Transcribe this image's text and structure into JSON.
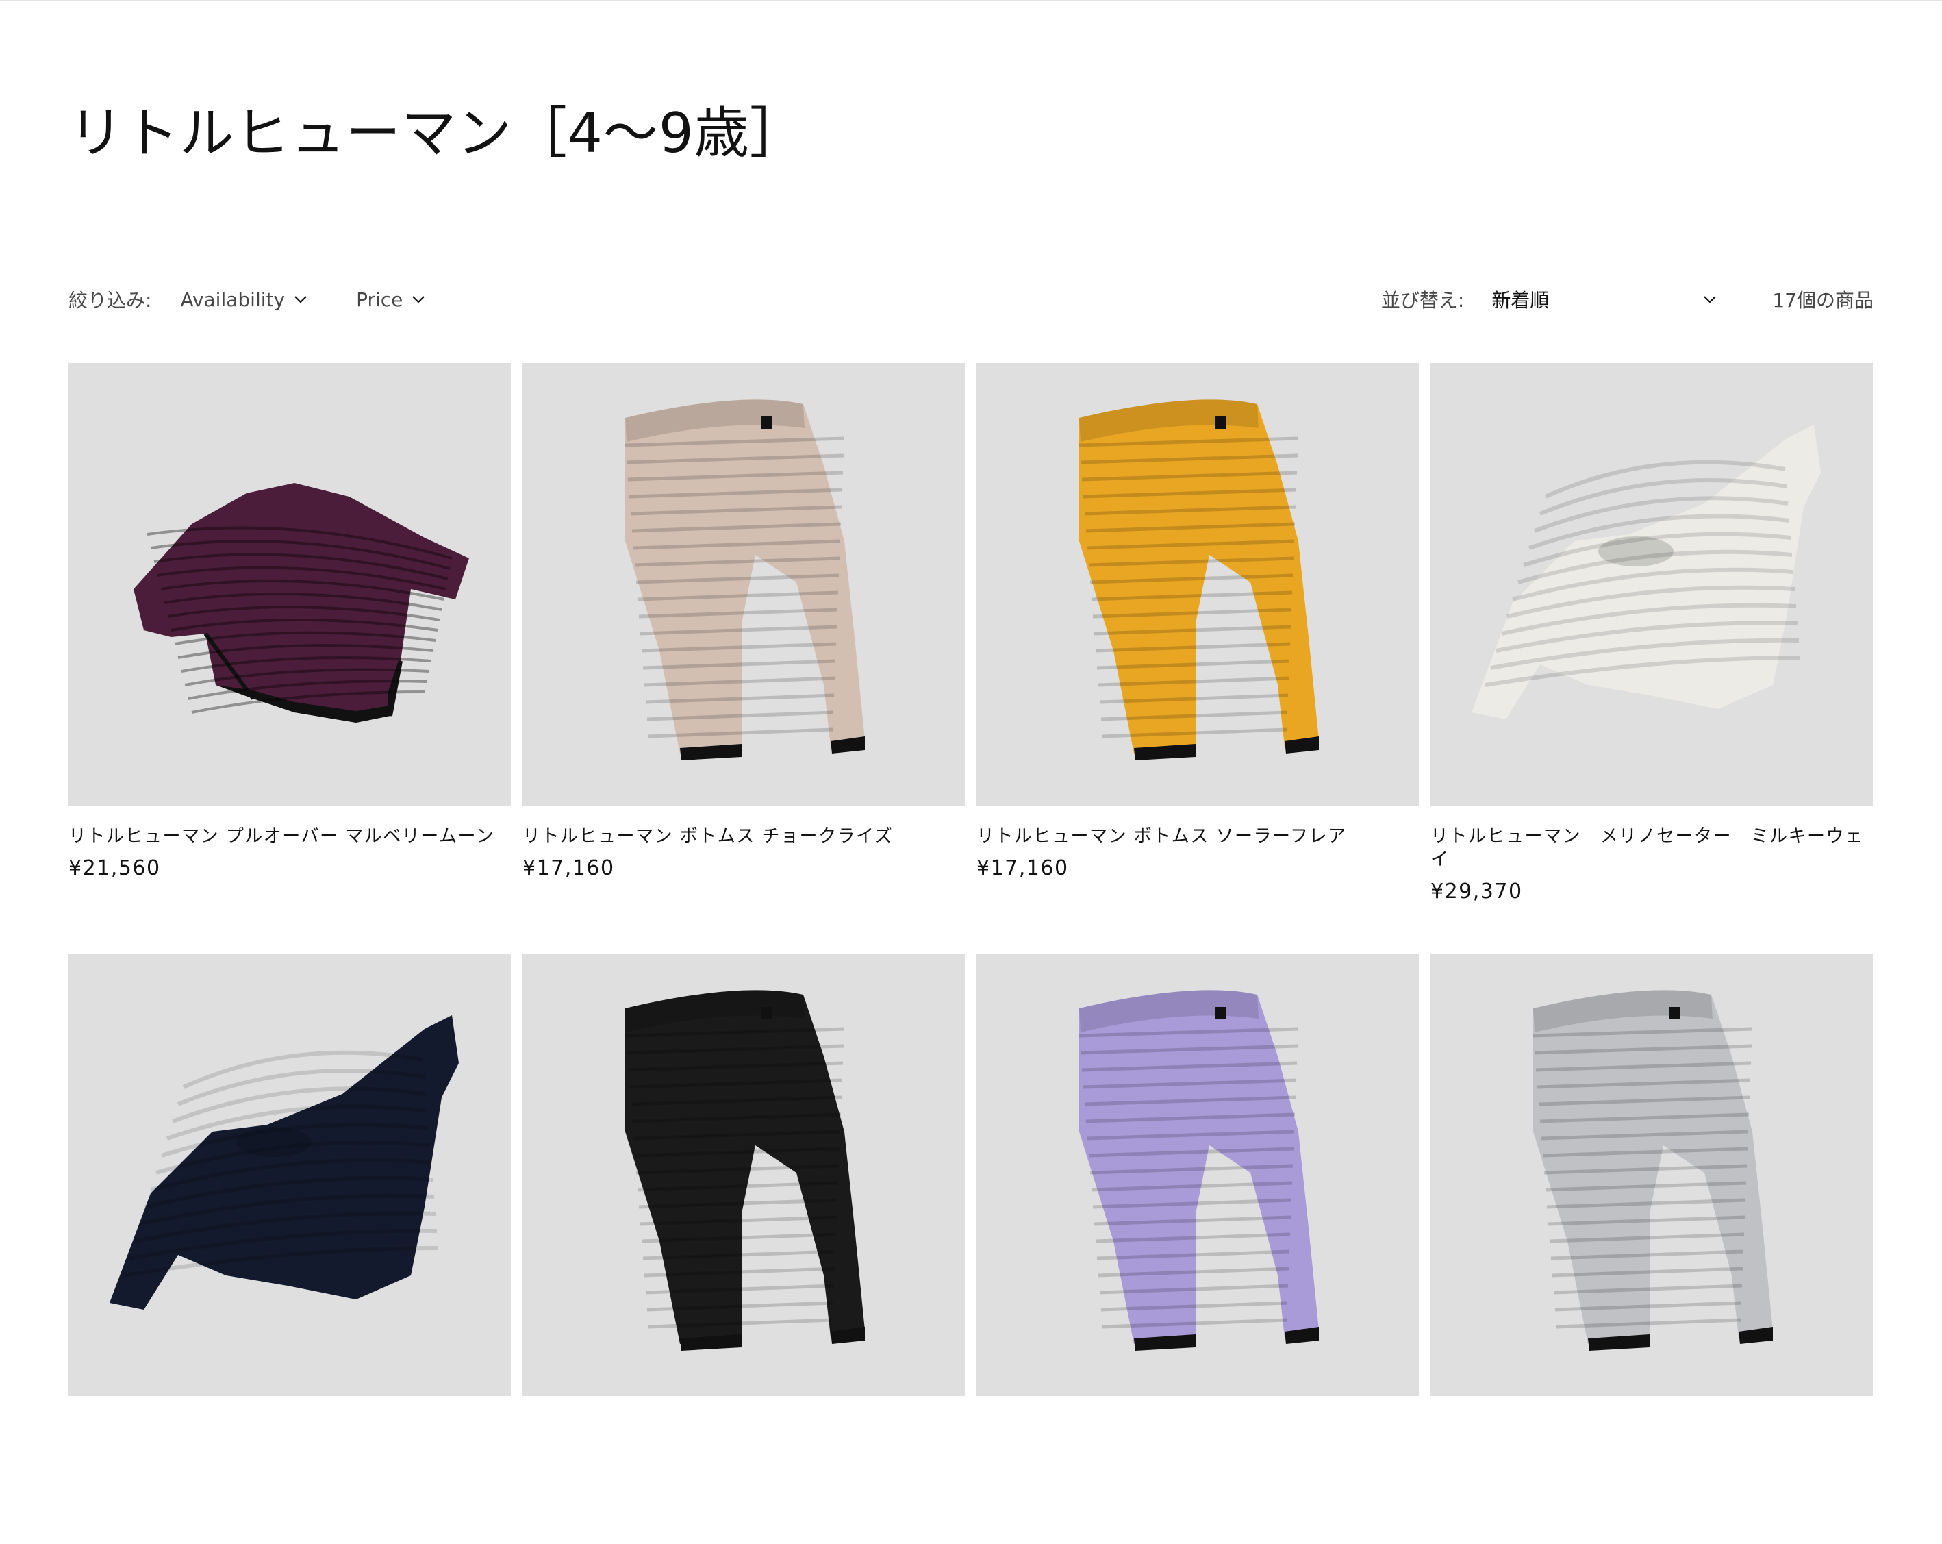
{
  "collection": {
    "title": "リトルヒューマン［4〜9歳］"
  },
  "filters": {
    "label": "絞り込み:",
    "availability_label": "Availability",
    "price_label": "Price"
  },
  "sort": {
    "label": "並び替え:",
    "selected": "新着順",
    "count_text": "17個の商品"
  },
  "products": [
    {
      "title": "リトルヒューマン プルオーバー マルベリームーン",
      "price": "¥21,560",
      "color": "#4b1d3a",
      "kind": "top"
    },
    {
      "title": "リトルヒューマン ボトムス チョークライズ",
      "price": "¥17,160",
      "color": "#d3bfb2",
      "kind": "pants"
    },
    {
      "title": "リトルヒューマン ボトムス ソーラーフレア",
      "price": "¥17,160",
      "color": "#e9a623",
      "kind": "pants"
    },
    {
      "title": "リトルヒューマン　メリノセーター　ミルキーウェイ",
      "price": "¥29,370",
      "color": "#ecebe6",
      "kind": "sweater"
    },
    {
      "title": "",
      "price": "",
      "color": "#141a2d",
      "kind": "sweater"
    },
    {
      "title": "",
      "price": "",
      "color": "#1a1a1a",
      "kind": "pants"
    },
    {
      "title": "",
      "price": "",
      "color": "#a99ad8",
      "kind": "pants"
    },
    {
      "title": "",
      "price": "",
      "color": "#bfc1c5",
      "kind": "pants"
    }
  ]
}
